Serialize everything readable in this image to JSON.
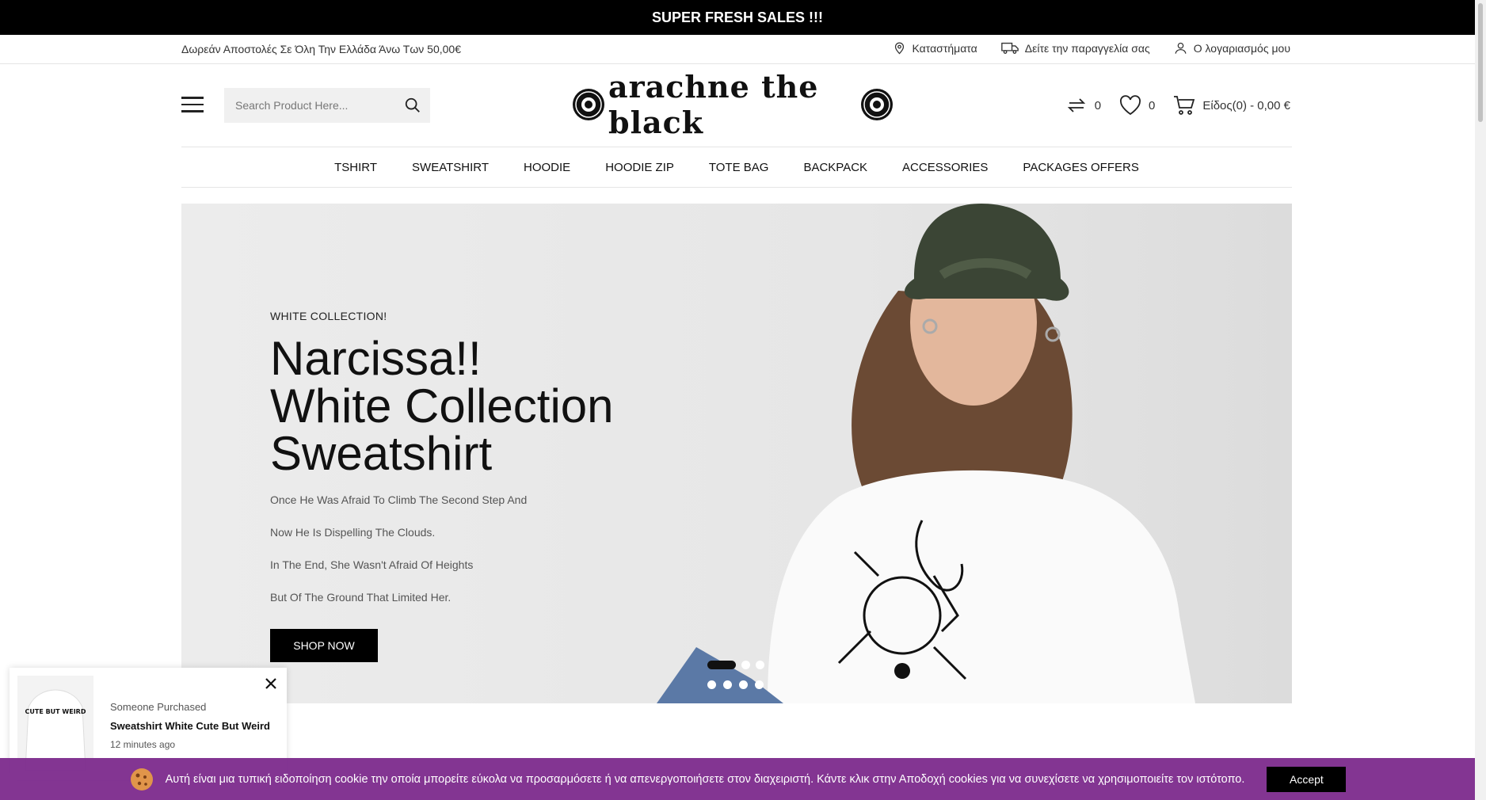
{
  "promo": {
    "text": "SUPER FRESH SALES !!!"
  },
  "topbar": {
    "shipping": "Δωρεάν Αποστολές Σε Όλη Την Ελλάδα Άνω Των 50,00€",
    "links": {
      "stores": "Καταστήματα",
      "track_order": "Δείτε την παραγγελία σας",
      "account": "Ο λογαριασμός μου"
    }
  },
  "header": {
    "search_placeholder": "Search Product Here...",
    "logo_text": "arachne the black",
    "compare_count": "0",
    "wishlist_count": "0",
    "cart_label": "Είδος(0) - 0,00 €",
    "icons": [
      "menu-icon",
      "search-icon",
      "compare-icon",
      "heart-icon",
      "cart-icon"
    ]
  },
  "nav": {
    "items": [
      "TSHIRT",
      "SWEATSHIRT",
      "HOODIE",
      "HOODIE ZIP",
      "TOTE BAG",
      "BACKPACK",
      "ACCESSORIES",
      "PACKAGES OFFERS"
    ]
  },
  "hero": {
    "kicker": "WHITE COLLECTION!",
    "title_lines": [
      "Narcissa!!",
      "White Collection",
      "Sweatshirt"
    ],
    "lines": [
      "Once He Was Afraid To Climb The Second Step And",
      "Now He Is Dispelling The Clouds.",
      "In The End, She Wasn't Afraid Of Heights",
      "But Of The Ground That Limited Her."
    ],
    "button": "SHOP NOW",
    "active_slide": 1,
    "slide_count": 3,
    "secondary_dot_count": 4
  },
  "popup": {
    "label": "Someone Purchased",
    "product": "Sweatshirt White Cute But Weird",
    "time": "12 minutes ago",
    "thumb_text": "CUTE BUT WEIRD"
  },
  "cookie": {
    "text": "Αυτή είναι μια τυπική ειδοποίηση cookie την οποία μπορείτε εύκολα να προσαρμόσετε ή να απενεργοποιήσετε στον διαχειριστή. Κάντε κλικ στην Αποδοχή cookies για να συνεχίσετε να χρησιμοποιείτε τον ιστότοπο.",
    "accept": "Accept"
  },
  "colors": {
    "promo_bg": "#000000",
    "cookie_bg": "#7c2a8c",
    "hero_bg": "#ebebeb",
    "button_bg": "#000000"
  }
}
